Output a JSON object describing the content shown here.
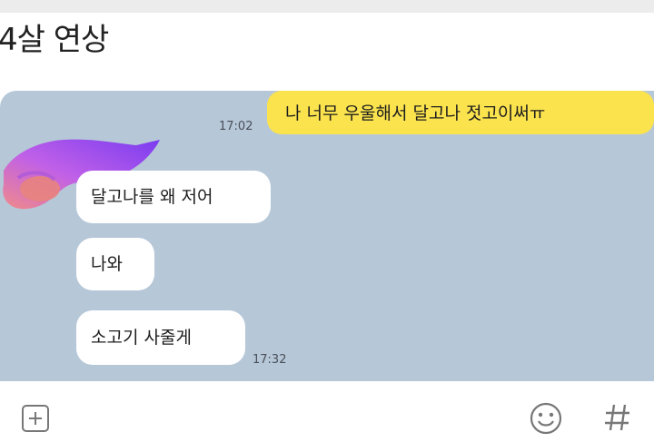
{
  "header": {
    "title": "4살 연상"
  },
  "messages": {
    "sent": {
      "text": "나 너무 우울해서 달고나 젓고이써ㅠ",
      "time": "17:02"
    },
    "received": [
      {
        "text": "달고나를 왜 저어"
      },
      {
        "text": "나와"
      },
      {
        "text": "소고기 사줄게"
      }
    ],
    "received_time": "17:32"
  },
  "colors": {
    "chat_background": "#b6c7d8",
    "sent_bubble": "#fbe34e",
    "received_bubble": "#ffffff"
  },
  "icons": {
    "attach": "plus-square-icon",
    "emoji": "smiley-icon",
    "hashtag": "hash-icon"
  }
}
